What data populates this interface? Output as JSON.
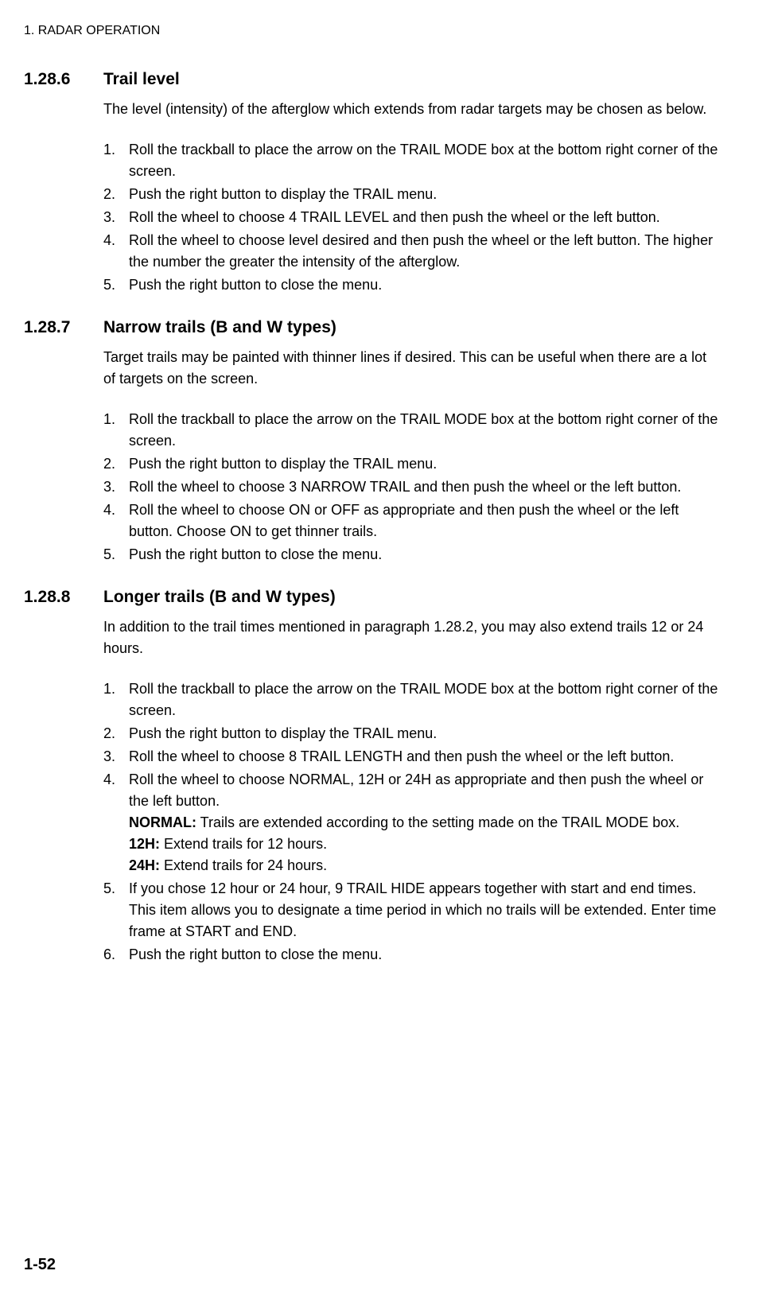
{
  "header": "1. RADAR OPERATION",
  "pageNumber": "1-52",
  "sections": [
    {
      "number": "1.28.6",
      "title": "Trail level",
      "intro": "The level (intensity) of the afterglow which extends from radar targets may be chosen as below.",
      "steps": [
        "Roll the trackball to place the arrow on the TRAIL MODE box at the bottom right corner of the screen.",
        "Push the right button to display the TRAIL menu.",
        "Roll the wheel to choose 4 TRAIL LEVEL and then push the wheel or the left button.",
        "Roll the wheel to choose level desired and then push the wheel or the left button. The higher the number the greater the intensity of the afterglow.",
        "Push the right button to close the menu."
      ]
    },
    {
      "number": "1.28.7",
      "title": "Narrow trails (B and W types)",
      "intro": "Target trails may be painted with thinner lines if desired. This can be useful when there are a lot of targets on the screen.",
      "steps": [
        "Roll the trackball to place the arrow on the TRAIL MODE box at the bottom right corner of the screen.",
        "Push the right button to display the TRAIL menu.",
        "Roll the wheel to choose 3 NARROW TRAIL and then push the wheel or the left button.",
        "Roll the wheel to choose ON or OFF as appropriate and then push the wheel or the left button. Choose ON to get thinner trails.",
        "Push the right button to close the menu."
      ]
    },
    {
      "number": "1.28.8",
      "title": "Longer trails (B and W types)",
      "intro": "In addition to the trail times mentioned in paragraph 1.28.2, you may also extend trails 12 or 24 hours.",
      "steps": [
        "Roll the trackball to place the arrow on the TRAIL MODE box at the bottom right corner of the screen.",
        "Push the right button to display the TRAIL menu.",
        "Roll the wheel to choose 8 TRAIL LENGTH and then push the wheel or the left button.",
        "Roll the wheel to choose NORMAL, 12H or 24H as appropriate and then push the wheel or the left button.",
        "If you chose 12 hour or 24 hour, 9 TRAIL HIDE appears together with start and end times. This item allows you to designate a time period in which no trails will be extended. Enter time frame at START and END.",
        "Push the right button to close the menu."
      ],
      "substeps": {
        "3": [
          {
            "label": "NORMAL:",
            "text": " Trails are extended according to the setting made on the TRAIL MODE box."
          },
          {
            "label": "12H:",
            "text": " Extend trails for 12 hours."
          },
          {
            "label": "24H:",
            "text": " Extend trails for 24 hours."
          }
        ]
      }
    }
  ]
}
